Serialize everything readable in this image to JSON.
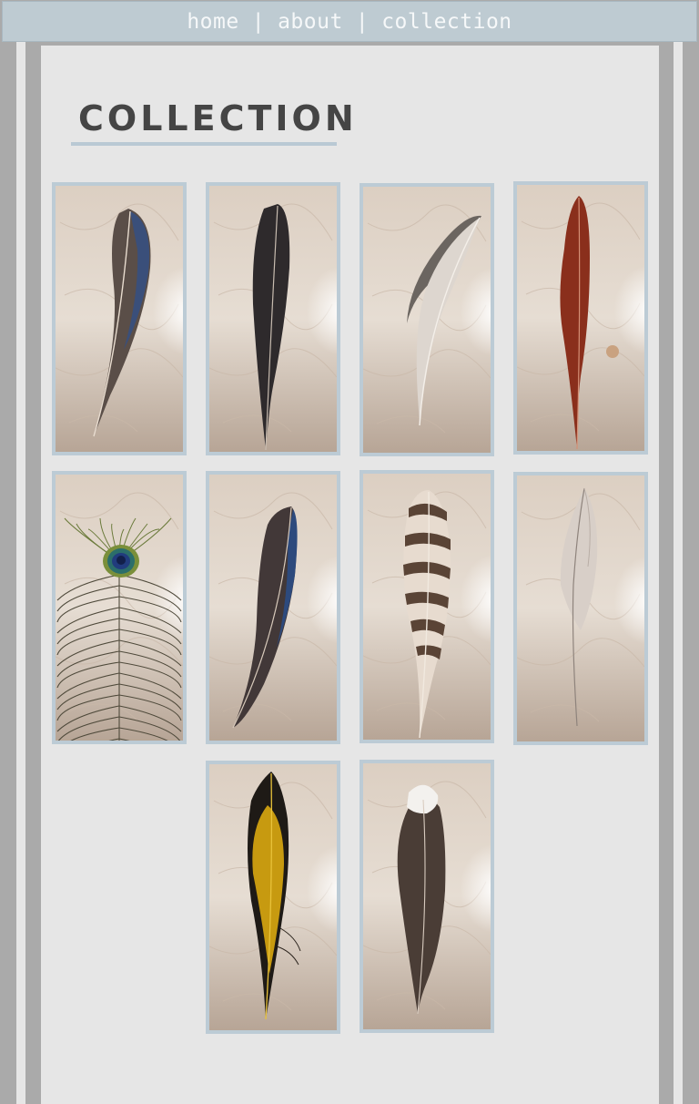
{
  "nav": {
    "home": "home",
    "about": "about",
    "collection": "collection",
    "separator": "|"
  },
  "page": {
    "title": "COLLECTION"
  },
  "gallery": {
    "items": [
      {
        "name": "feather-blue-dark"
      },
      {
        "name": "feather-black"
      },
      {
        "name": "feather-grey-white"
      },
      {
        "name": "feather-red"
      },
      {
        "name": "feather-peacock"
      },
      {
        "name": "feather-blue-black"
      },
      {
        "name": "feather-barred-brown"
      },
      {
        "name": "feather-pale-white"
      },
      {
        "name": "feather-black-yellow"
      },
      {
        "name": "feather-brown-white-tip"
      }
    ]
  },
  "colors": {
    "nav_bg": "#becbd2",
    "panel_bg": "#e6e6e6",
    "accent_line": "#b9c9d4",
    "tile_border": "#bccbd5"
  }
}
